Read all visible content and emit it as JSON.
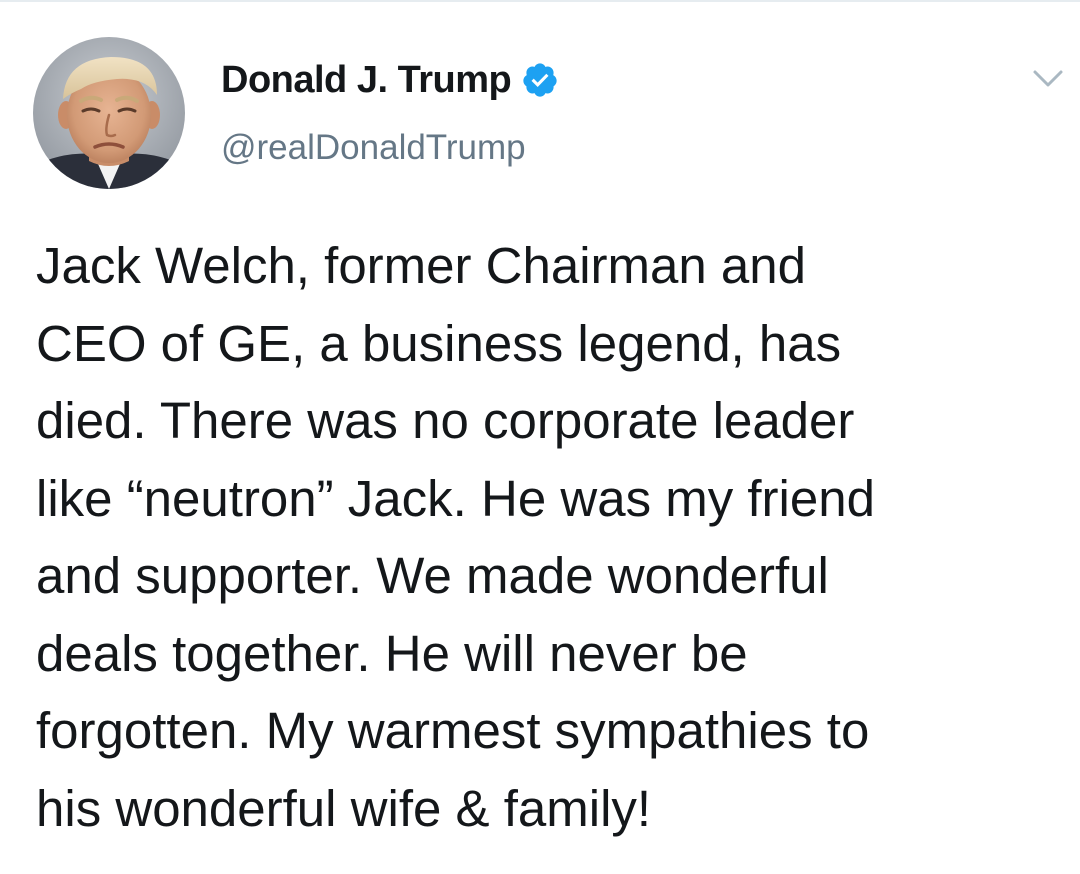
{
  "author": {
    "name": "Donald J. Trump",
    "handle": "@realDonaldTrump",
    "verified": true,
    "verified_color": "#1da1f2"
  },
  "icons": {
    "avatar": "profile-photo",
    "verified": "verified-check-badge-icon",
    "menu": "chevron-down-icon"
  },
  "tweet": {
    "lines": [
      "Jack Welch, former Chairman and",
      "CEO of GE, a business legend, has",
      "died. There was no corporate leader",
      "like “neutron” Jack. He was my friend",
      "and supporter. We made wonderful",
      "deals together. He will never be",
      "forgotten. My warmest sympathies to",
      "his wonderful wife & family!"
    ]
  },
  "colors": {
    "text": "#14171a",
    "secondary_text": "#657786",
    "background": "#ffffff",
    "caret": "#aab8c2"
  }
}
